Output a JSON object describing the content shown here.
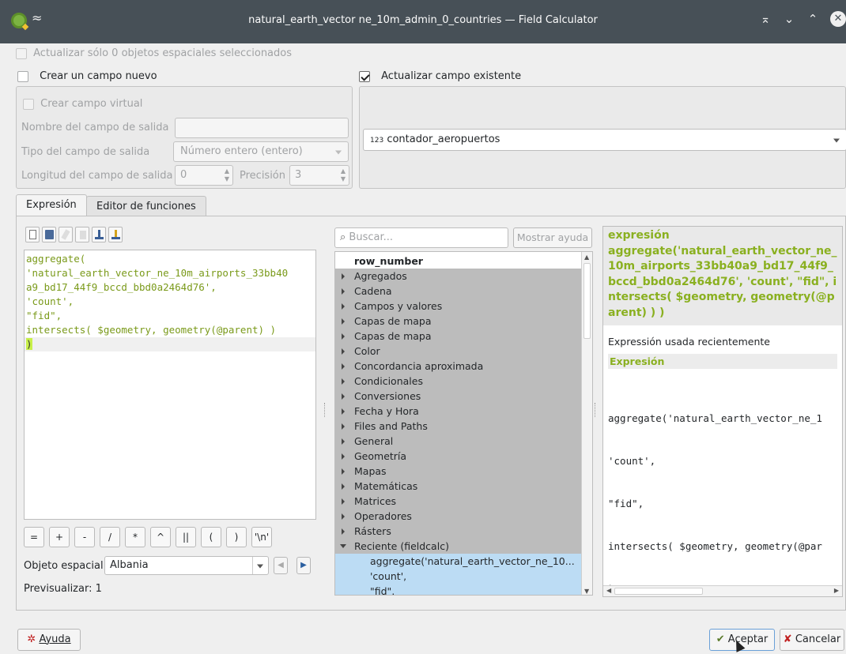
{
  "window": {
    "title": "natural_earth_vector ne_10m_admin_0_countries — Field Calculator"
  },
  "top": {
    "update_selected": "Actualizar sólo 0 objetos espaciales seleccionados",
    "create_new": "Crear un campo nuevo",
    "update_existing": "Actualizar campo existente",
    "virtual_field": "Crear campo virtual",
    "output_name_label": "Nombre del campo de salida",
    "output_type_label": "Tipo del campo de salida",
    "output_type_value": "Número entero (entero)",
    "output_length_label": "Longitud del campo de salida",
    "output_length_value": "0",
    "precision_label": "Precisión",
    "precision_value": "3",
    "existing_field_prefix": "123",
    "existing_field_value": "contador_aeropuertos"
  },
  "tabs": [
    "Expresión",
    "Editor de funciones"
  ],
  "editor": {
    "lines": [
      "aggregate(",
      "'natural_earth_vector_ne_10m_airports_33bb40",
      "a9_bd17_44f9_bccd_bbd0a2464d76',",
      "'count',",
      "\"fid\",",
      "intersects( $geometry, geometry(@parent) )",
      ")"
    ]
  },
  "operators": [
    "=",
    "+",
    "-",
    "/",
    "*",
    "^",
    "||",
    "(",
    ")",
    "'\\n'"
  ],
  "feature": {
    "label": "Objeto espacial",
    "value": "Albania"
  },
  "preview": {
    "label": "Previsualizar:",
    "value": "1"
  },
  "search": {
    "placeholder": "Buscar...",
    "help_button": "Mostrar ayuda"
  },
  "tree": {
    "top_item": "row_number",
    "groups": [
      "Agregados",
      "Cadena",
      "Campos y valores",
      "Capas de mapa",
      "Capas de mapa",
      "Color",
      "Concordancia aproximada",
      "Condicionales",
      "Conversiones",
      "Fecha y Hora",
      "Files and Paths",
      "General",
      "Geometría",
      "Mapas",
      "Matemáticas",
      "Matrices",
      "Operadores",
      "Rásters"
    ],
    "expanded_group": "Reciente (fieldcalc)",
    "sub_items": [
      "aggregate('natural_earth_vector_ne_10...",
      "'count',",
      "\"fid\","
    ]
  },
  "help": {
    "heading": "expresión",
    "expression": "aggregate('natural_earth_vector_ne_10m_airports_33bb40a9_bd17_44f9_bccd_bbd0a2464d76', 'count', \"fid\", intersects( $geometry, geometry(@parent) ) )",
    "recent_label": "Expressión usada recientemente",
    "section_title": "Expresión",
    "code_lines": [
      "aggregate('natural_earth_vector_ne_1",
      "'count',",
      "\"fid\",",
      "intersects( $geometry, geometry(@par",
      ")"
    ]
  },
  "buttons": {
    "help": "Ayuda",
    "ok": "Aceptar",
    "cancel": "Cancelar"
  }
}
